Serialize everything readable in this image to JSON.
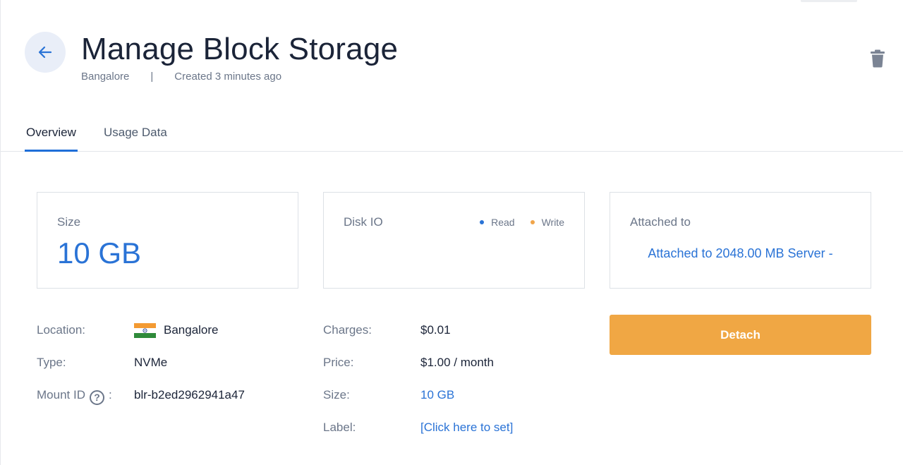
{
  "header": {
    "title": "Manage Block Storage",
    "location": "Bangalore",
    "separator": "|",
    "created": "Created 3 minutes ago",
    "back_icon": "arrow-left-icon",
    "delete_icon": "trash-icon"
  },
  "tabs": [
    {
      "label": "Overview",
      "active": true
    },
    {
      "label": "Usage Data",
      "active": false
    }
  ],
  "cards": {
    "size": {
      "label": "Size",
      "value": "10 GB"
    },
    "disk_io": {
      "label": "Disk IO",
      "legend_read": "Read",
      "legend_write": "Write"
    },
    "attached": {
      "label": "Attached to",
      "link": "Attached to 2048.00 MB Server -"
    }
  },
  "details_left": {
    "location_label": "Location:",
    "location_value": "Bangalore",
    "location_flag": "india-flag-icon",
    "type_label": "Type:",
    "type_value": "NVMe",
    "mount_label": "Mount ID",
    "mount_colon": ":",
    "mount_help": "?",
    "mount_value": "blr-b2ed2962941a47"
  },
  "details_right": {
    "charges_label": "Charges:",
    "charges_value": "$0.01",
    "price_label": "Price:",
    "price_value": "$1.00 / month",
    "size_label": "Size:",
    "size_value": "10 GB",
    "label_label": "Label:",
    "label_value": "[Click here to set]"
  },
  "actions": {
    "detach_label": "Detach"
  },
  "colors": {
    "accent_blue": "#2a73d6",
    "detach_orange": "#f0a744",
    "write_dot": "#f0a54a"
  }
}
